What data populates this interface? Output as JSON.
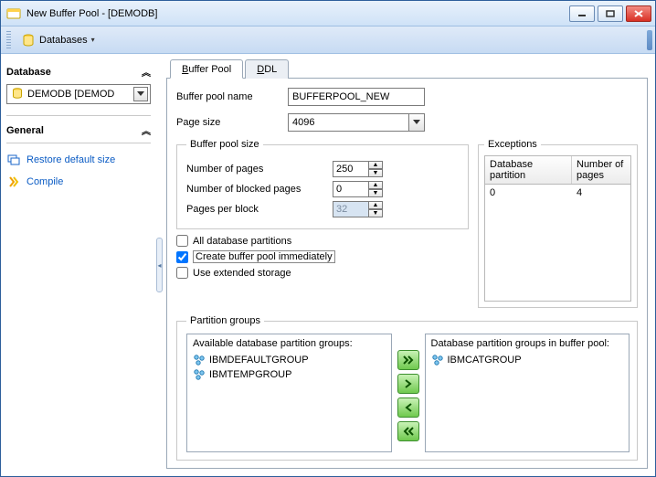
{
  "window": {
    "title": "New Buffer Pool - [DEMODB]"
  },
  "menubar": {
    "databases_label": "Databases"
  },
  "sidebar": {
    "section_database": "Database",
    "db_selected": "DEMODB [DEMOD",
    "section_general": "General",
    "restore_link": "Restore default size",
    "compile_link": "Compile"
  },
  "tabs": {
    "buffer_pool": "uffer Pool",
    "buffer_pool_prefix": "B",
    "ddl": "DL",
    "ddl_prefix": "D"
  },
  "form": {
    "name_label": "Buffer pool name",
    "name_value": "BUFFERPOOL_NEW",
    "pagesize_label": "Page size",
    "pagesize_value": "4096",
    "size_legend": "Buffer pool size",
    "num_pages_label": "Number of pages",
    "num_pages_value": "250",
    "blocked_label": "Number of blocked pages",
    "blocked_value": "0",
    "ppb_label": "Pages per block",
    "ppb_value": "32",
    "chk_all_partitions": "All database partitions",
    "chk_create_immediate": "Create buffer pool immediately",
    "chk_extended": "Use extended storage"
  },
  "exceptions": {
    "legend": "Exceptions",
    "col_partition": "Database partition",
    "col_pages": "Number of pages",
    "rows": [
      {
        "partition": "0",
        "pages": "4"
      }
    ]
  },
  "pgroups": {
    "legend": "Partition groups",
    "available_label": "Available database partition groups:",
    "inpool_label": "Database partition groups in buffer pool:",
    "available": [
      "IBMDEFAULTGROUP",
      "IBMTEMPGROUP"
    ],
    "inpool": [
      "IBMCATGROUP"
    ]
  }
}
